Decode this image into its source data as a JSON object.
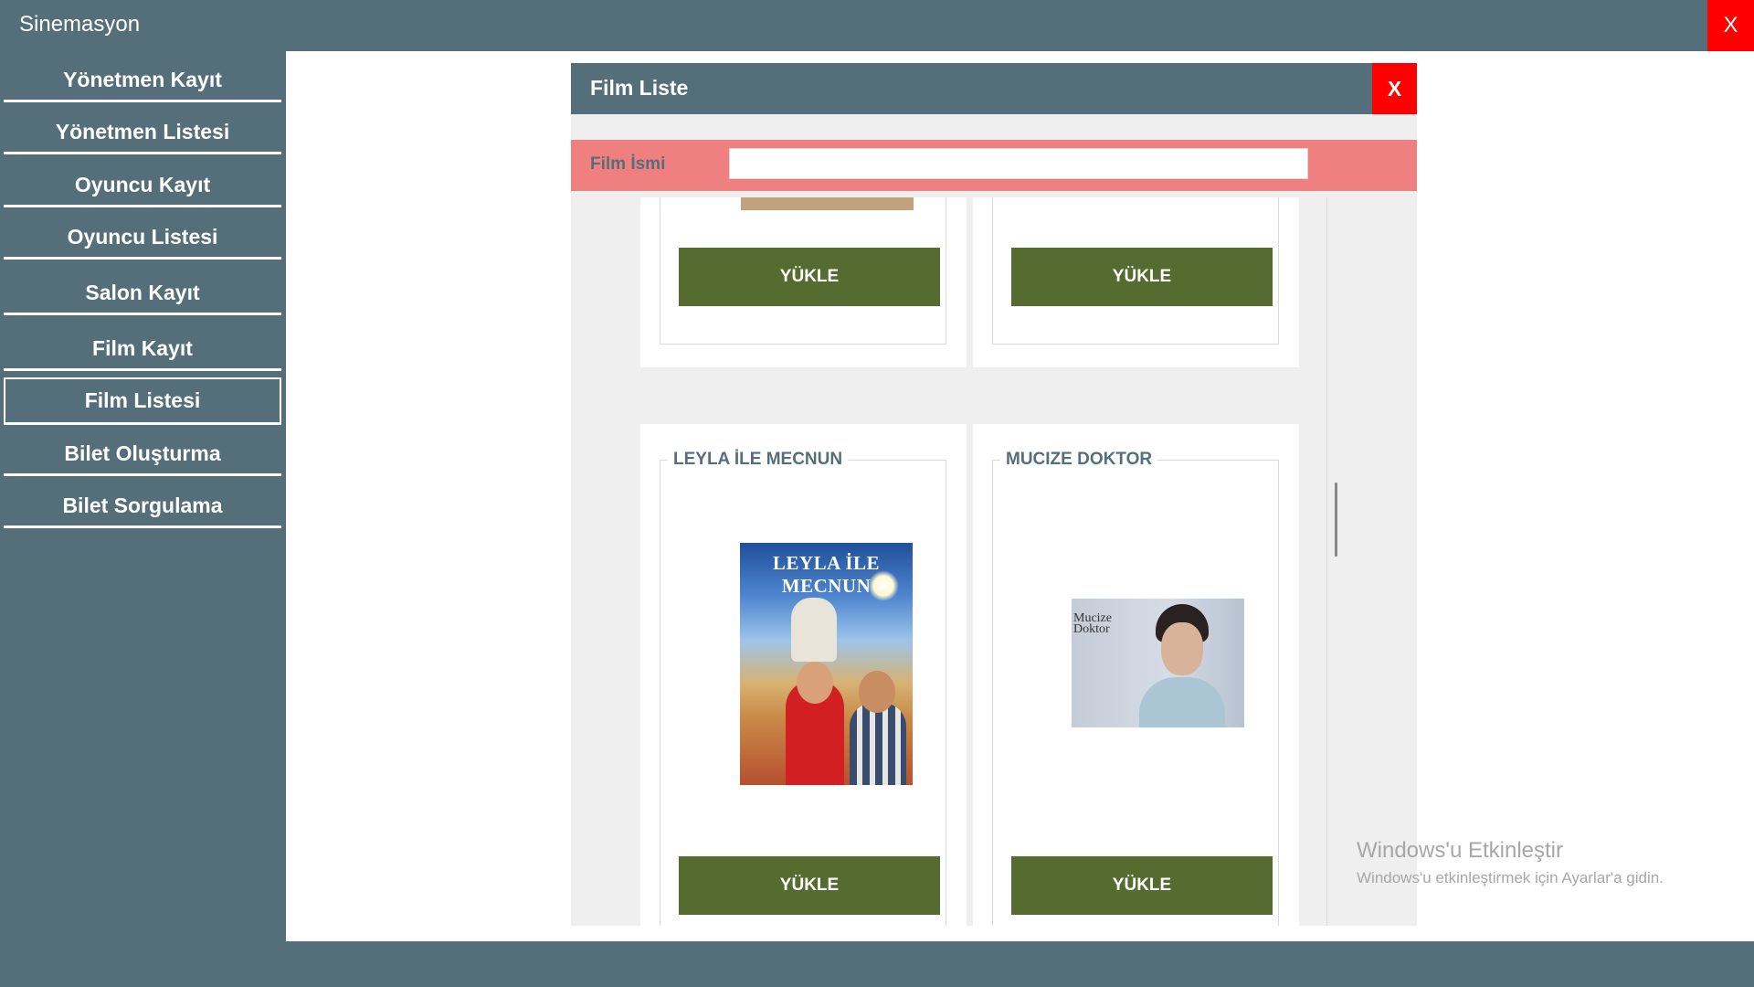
{
  "app": {
    "title": "Sinemasyon",
    "close_label": "X"
  },
  "sidebar": {
    "items": [
      {
        "label": "Yönetmen Kayıt"
      },
      {
        "label": "Yönetmen Listesi"
      },
      {
        "label": "Oyuncu Kayıt"
      },
      {
        "label": "Oyuncu Listesi"
      },
      {
        "label": "Salon Kayıt"
      },
      {
        "label": "Film Kayıt"
      },
      {
        "label": "Film Listesi",
        "active": true
      },
      {
        "label": "Bilet Oluşturma"
      },
      {
        "label": "Bilet Sorgulama"
      }
    ]
  },
  "film_window": {
    "title": "Film Liste",
    "close_label": "X",
    "search": {
      "label": "Film İsmi",
      "value": "",
      "placeholder": ""
    },
    "cards": [
      {
        "title": "",
        "button_label": "YÜKLE"
      },
      {
        "title": "",
        "button_label": "YÜKLE"
      },
      {
        "title": "LEYLA İLE MECNUN",
        "button_label": "YÜKLE",
        "poster_text": "LEYLA İLE MECNUN"
      },
      {
        "title": "MUCIZE DOKTOR",
        "button_label": "YÜKLE",
        "poster_text": "Mucize Doktor"
      }
    ]
  },
  "watermark": {
    "title": "Windows'u Etkinleştir",
    "subtitle": "Windows'u etkinleştirmek için Ayarlar'a gidin."
  },
  "colors": {
    "slate": "#546e7a",
    "close_red": "#ff0000",
    "search_bar": "#f08080",
    "button_olive": "#556b2f"
  }
}
